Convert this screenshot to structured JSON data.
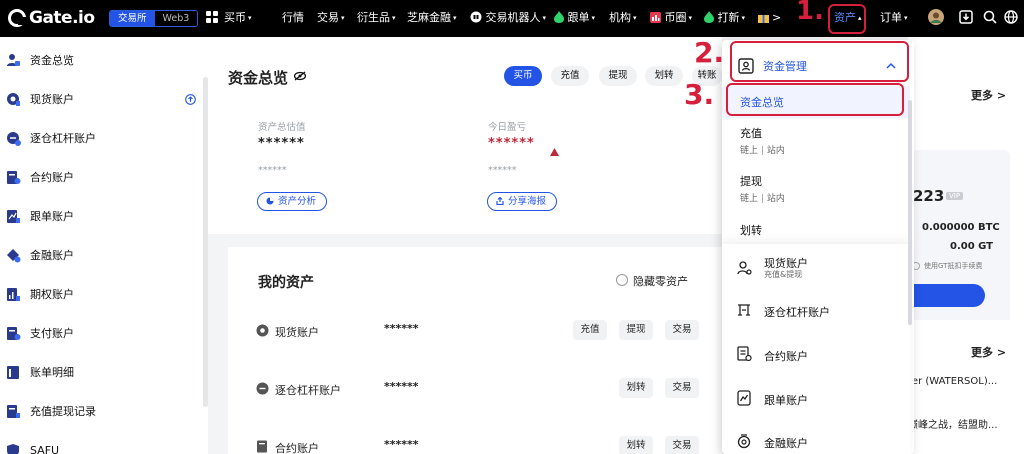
{
  "nav": {
    "logo": "Gate.io",
    "seg_exchange": "交易所",
    "seg_web3": "Web3",
    "items": [
      {
        "label": "买币",
        "caret": "▾"
      },
      {
        "label": "行情",
        "caret": ""
      },
      {
        "label": "交易",
        "caret": "▾"
      },
      {
        "label": "衍生品",
        "caret": "▾"
      },
      {
        "label": "芝麻金融",
        "caret": "▾"
      },
      {
        "label": "交易机器人",
        "caret": "▾"
      },
      {
        "label": "跟单",
        "caret": "▾"
      },
      {
        "label": "机构",
        "caret": "▾"
      },
      {
        "label": "币圈",
        "caret": "▾"
      },
      {
        "label": "打新",
        "caret": "▾"
      }
    ],
    "more": ">",
    "assets": "资产",
    "assets_caret": "▴",
    "orders": "订单",
    "orders_caret": "▾"
  },
  "annotations": {
    "step1": "1.",
    "step2": "2.",
    "step3": "3."
  },
  "sidebar": {
    "items": [
      {
        "label": "资金总览",
        "active": true
      },
      {
        "label": "现货账户"
      },
      {
        "label": "逐仓杠杆账户"
      },
      {
        "label": "合约账户"
      },
      {
        "label": "跟单账户"
      },
      {
        "label": "金融账户"
      },
      {
        "label": "期权账户"
      },
      {
        "label": "支付账户"
      },
      {
        "label": "账单明细"
      },
      {
        "label": "充值提现记录"
      },
      {
        "label": "SAFU"
      }
    ]
  },
  "overview": {
    "title": "资金总览",
    "buttons": [
      "买币",
      "充值",
      "提现",
      "划转",
      "转账"
    ],
    "total_label": "资产总估值",
    "total_value": "******",
    "total_sub": "******",
    "analysis_btn": "资产分析",
    "pnl_label": "今日盈亏",
    "pnl_value": "******",
    "pnl_sub": "******",
    "share_btn": "分享海报"
  },
  "my_assets": {
    "title": "我的资产",
    "hide_zero": "隐藏零资产",
    "rows": [
      {
        "name": "现货账户",
        "value": "******",
        "actions": [
          "充值",
          "提现",
          "交易"
        ]
      },
      {
        "name": "逐仓杠杆账户",
        "value": "******",
        "actions": [
          "划转",
          "交易"
        ]
      },
      {
        "name": "合约账户",
        "value": "******",
        "actions": [
          "划转",
          "交易"
        ]
      }
    ]
  },
  "right_panel": {
    "more1": "更多 >",
    "number": "223",
    "badge": "VIP",
    "btc": "0.000000 BTC",
    "gt": "0.00 GT",
    "gt_note": "使用GT抵扣手续费",
    "more2": "更多 >",
    "news1": "ter (WATERSOL)...",
    "news2": "巅峰之战，结盟助..."
  },
  "dropdown": {
    "header": "资金管理",
    "overview": "资金总览",
    "deposit": "充值",
    "deposit_sub_a": "链上",
    "deposit_sub_b": "站内",
    "withdraw": "提现",
    "withdraw_sub_a": "链上",
    "withdraw_sub_b": "站内",
    "transfer": "划转",
    "spot": "现货账户",
    "spot_sub": "充值&提现",
    "margin": "逐仓杠杆账户",
    "futures": "合约账户",
    "copy": "跟单账户",
    "finance": "金融账户"
  },
  "colors": {
    "accent": "#2354e6",
    "annotation": "#d61f3c",
    "loss": "#c0283c"
  }
}
